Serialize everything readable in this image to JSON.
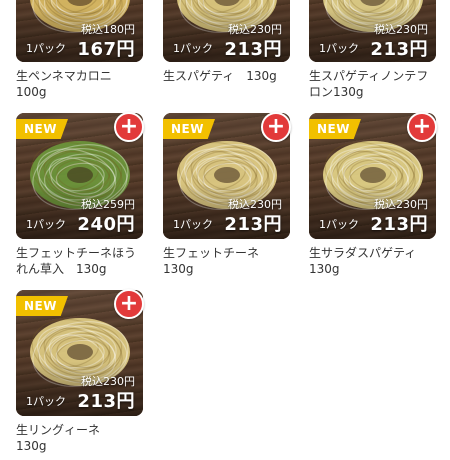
{
  "products": [
    {
      "name": "生ペンネマカロニ\n100g",
      "tax_price": "税込180円",
      "unit": "1パック",
      "price": "167円",
      "color": "#e8c86a",
      "new": false
    },
    {
      "name": "生スパゲティ　130g",
      "tax_price": "税込230円",
      "unit": "1パック",
      "price": "213円",
      "color": "#ecd98a",
      "new": false
    },
    {
      "name": "生スパゲティノンテフ\nロン130g",
      "tax_price": "税込230円",
      "unit": "1パック",
      "price": "213円",
      "color": "#eedf93",
      "new": false
    },
    {
      "name": "生フェットチーネほう\nれん草入　130g",
      "tax_price": "税込259円",
      "unit": "1パック",
      "price": "240円",
      "color": "#6f9f3c",
      "new": true
    },
    {
      "name": "生フェットチーネ\n130g",
      "tax_price": "税込230円",
      "unit": "1パック",
      "price": "213円",
      "color": "#eedc8e",
      "new": true
    },
    {
      "name": "生サラダスパゲティ\n130g",
      "tax_price": "税込230円",
      "unit": "1パック",
      "price": "213円",
      "color": "#f0e090",
      "new": true
    },
    {
      "name": "生リングィーネ\n130g",
      "tax_price": "税込230円",
      "unit": "1パック",
      "price": "213円",
      "color": "#ecd98c",
      "new": true
    }
  ],
  "badge_label": "NEW",
  "add_label": "+",
  "colors": {
    "badge": "#f2c000",
    "add_button": "#e23a3a"
  }
}
